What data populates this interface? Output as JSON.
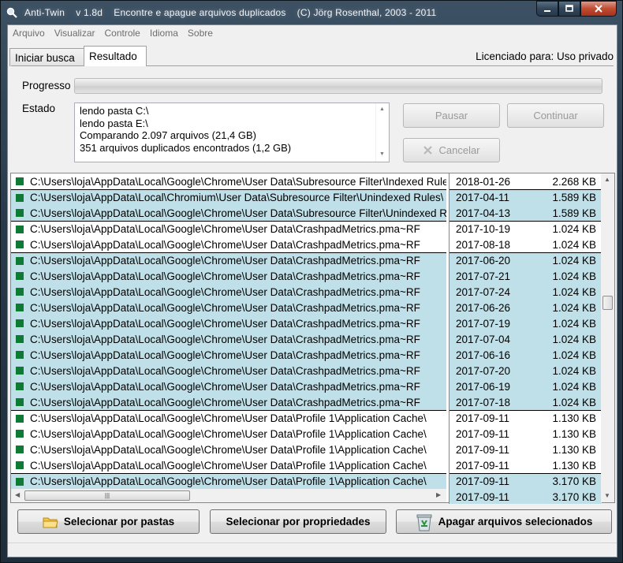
{
  "window": {
    "title": "Anti-Twin    v 1.8d    Encontre e apague arquivos duplicados    (C) Jörg Rosenthal, 2003 - 2011",
    "buttons": {
      "minimize_icon": "minimize-icon",
      "maximize_icon": "maximize-icon",
      "close_icon": "close-icon"
    }
  },
  "menu": [
    "Arquivo",
    "Visualizar",
    "Controle",
    "Idioma",
    "Sobre"
  ],
  "tabs": [
    {
      "label": "Iniciar busca",
      "active": false
    },
    {
      "label": "Resultado",
      "active": true
    }
  ],
  "license": "Licenciado para: Uso privado",
  "progress": {
    "label": "Progresso",
    "value": 0
  },
  "status": {
    "label": "Estado",
    "lines": [
      "lendo pasta C:\\",
      "lendo pasta E:\\",
      "Comparando 2.097 arquivos (21,4 GB)",
      "351 arquivos duplicados encontrados (1,2 GB)"
    ]
  },
  "controls": {
    "pause": "Pausar",
    "continue": "Continuar",
    "cancel": "Cancelar"
  },
  "colors": {
    "highlight": "#bfe0e8",
    "checkbox": "#0e7a34",
    "selection": "#26a0da"
  },
  "files": [
    {
      "path": "C:\\Users\\loja\\AppData\\Local\\Google\\Chrome\\User Data\\Subresource Filter\\Indexed Rules\\",
      "date": "2018-01-26",
      "size": "2.268 KB",
      "hl": false,
      "sep": false
    },
    {
      "path": "C:\\Users\\loja\\AppData\\Local\\Chromium\\User Data\\Subresource Filter\\Unindexed Rules\\",
      "date": "2017-04-11",
      "size": "1.589 KB",
      "hl": true,
      "sep": true
    },
    {
      "path": "C:\\Users\\loja\\AppData\\Local\\Google\\Chrome\\User Data\\Subresource Filter\\Unindexed Rules\\",
      "date": "2017-04-13",
      "size": "1.589 KB",
      "hl": true,
      "sep": false
    },
    {
      "path": "C:\\Users\\loja\\AppData\\Local\\Google\\Chrome\\User Data\\CrashpadMetrics.pma~RF",
      "date": "2017-10-19",
      "size": "1.024 KB",
      "hl": false,
      "sep": true
    },
    {
      "path": "C:\\Users\\loja\\AppData\\Local\\Google\\Chrome\\User Data\\CrashpadMetrics.pma~RF",
      "date": "2017-08-18",
      "size": "1.024 KB",
      "hl": false,
      "sep": false
    },
    {
      "path": "C:\\Users\\loja\\AppData\\Local\\Google\\Chrome\\User Data\\CrashpadMetrics.pma~RF",
      "date": "2017-06-20",
      "size": "1.024 KB",
      "hl": true,
      "sep": true
    },
    {
      "path": "C:\\Users\\loja\\AppData\\Local\\Google\\Chrome\\User Data\\CrashpadMetrics.pma~RF",
      "date": "2017-07-21",
      "size": "1.024 KB",
      "hl": true,
      "sep": false
    },
    {
      "path": "C:\\Users\\loja\\AppData\\Local\\Google\\Chrome\\User Data\\CrashpadMetrics.pma~RF",
      "date": "2017-07-24",
      "size": "1.024 KB",
      "hl": true,
      "sep": false
    },
    {
      "path": "C:\\Users\\loja\\AppData\\Local\\Google\\Chrome\\User Data\\CrashpadMetrics.pma~RF",
      "date": "2017-06-26",
      "size": "1.024 KB",
      "hl": true,
      "sep": false
    },
    {
      "path": "C:\\Users\\loja\\AppData\\Local\\Google\\Chrome\\User Data\\CrashpadMetrics.pma~RF",
      "date": "2017-07-19",
      "size": "1.024 KB",
      "hl": true,
      "sep": false
    },
    {
      "path": "C:\\Users\\loja\\AppData\\Local\\Google\\Chrome\\User Data\\CrashpadMetrics.pma~RF",
      "date": "2017-07-04",
      "size": "1.024 KB",
      "hl": true,
      "sep": false
    },
    {
      "path": "C:\\Users\\loja\\AppData\\Local\\Google\\Chrome\\User Data\\CrashpadMetrics.pma~RF",
      "date": "2017-06-16",
      "size": "1.024 KB",
      "hl": true,
      "sep": false
    },
    {
      "path": "C:\\Users\\loja\\AppData\\Local\\Google\\Chrome\\User Data\\CrashpadMetrics.pma~RF",
      "date": "2017-07-20",
      "size": "1.024 KB",
      "hl": true,
      "sep": false
    },
    {
      "path": "C:\\Users\\loja\\AppData\\Local\\Google\\Chrome\\User Data\\CrashpadMetrics.pma~RF",
      "date": "2017-06-19",
      "size": "1.024 KB",
      "hl": true,
      "sep": false
    },
    {
      "path": "C:\\Users\\loja\\AppData\\Local\\Google\\Chrome\\User Data\\CrashpadMetrics.pma~RF",
      "date": "2017-07-18",
      "size": "1.024 KB",
      "hl": true,
      "sep": false
    },
    {
      "path": "C:\\Users\\loja\\AppData\\Local\\Google\\Chrome\\User Data\\Profile 1\\Application Cache\\",
      "date": "2017-09-11",
      "size": "1.130 KB",
      "hl": false,
      "sep": true
    },
    {
      "path": "C:\\Users\\loja\\AppData\\Local\\Google\\Chrome\\User Data\\Profile 1\\Application Cache\\",
      "date": "2017-09-11",
      "size": "1.130 KB",
      "hl": false,
      "sep": false
    },
    {
      "path": "C:\\Users\\loja\\AppData\\Local\\Google\\Chrome\\User Data\\Profile 1\\Application Cache\\",
      "date": "2017-09-11",
      "size": "1.130 KB",
      "hl": false,
      "sep": false
    },
    {
      "path": "C:\\Users\\loja\\AppData\\Local\\Google\\Chrome\\User Data\\Profile 1\\Application Cache\\",
      "date": "2017-09-11",
      "size": "1.130 KB",
      "hl": false,
      "sep": false
    },
    {
      "path": "C:\\Users\\loja\\AppData\\Local\\Google\\Chrome\\User Data\\Profile 1\\Application Cache\\",
      "date": "2017-09-11",
      "size": "3.170 KB",
      "hl": true,
      "sep": true
    },
    {
      "path": "",
      "date": "2017-09-11",
      "size": "3.170 KB",
      "hl": true,
      "sep": false
    }
  ],
  "actions": {
    "select_folders": "Selecionar por pastas",
    "select_properties": "Selecionar por propriedades",
    "delete_selected": "Apagar arquivos selecionados"
  },
  "icons": {
    "folder": "folder-icon",
    "trash": "recycle-bin-icon",
    "app": "magnifier-icon"
  }
}
